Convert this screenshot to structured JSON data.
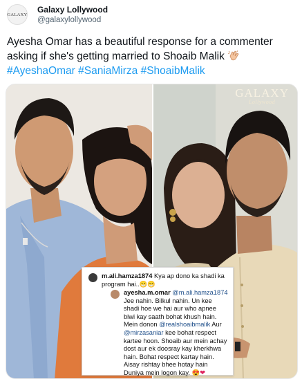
{
  "tweet": {
    "account_name": "Galaxy Lollywood",
    "handle": "@galaxylollywood",
    "avatar_text": "GALAXY",
    "text_main": "Ayesha Omar has a beautiful response for a commenter asking if she's getting married to Shoaib Malik",
    "hashtags": [
      "#AyeshaOmar",
      "#SaniaMirza",
      "#ShoaibMalik"
    ]
  },
  "media": {
    "watermark_title": "GALAXY",
    "watermark_sub": "Lollywood"
  },
  "instagram_comment": {
    "commenter": "m.ali.hamza1874",
    "comment_text": "Kya ap dono ka shadi ka program hai..😁😁",
    "reply_user": "ayesha.m.omar",
    "reply_mention": "@m.ali.hamza1874",
    "reply_part1": "Jee nahin. Bilkul nahin. Un kee shadi hoe we hai aur who apnee biwi kay saath bohat khush hain. Mein donon",
    "reply_mention2": "@realshoaibmalik",
    "reply_part2": "Aur",
    "reply_mention3": "@mirzasaniar",
    "reply_part3": "kee bohat respect kartee hoon. Shoaib aur mein achay dost aur ek doosray kay kherkhwa hain. Bohat respect kartay hain. Aisay rishtay bhee hotay hain Duniya mein logon kay.",
    "reply_emoji": "😍❤"
  }
}
